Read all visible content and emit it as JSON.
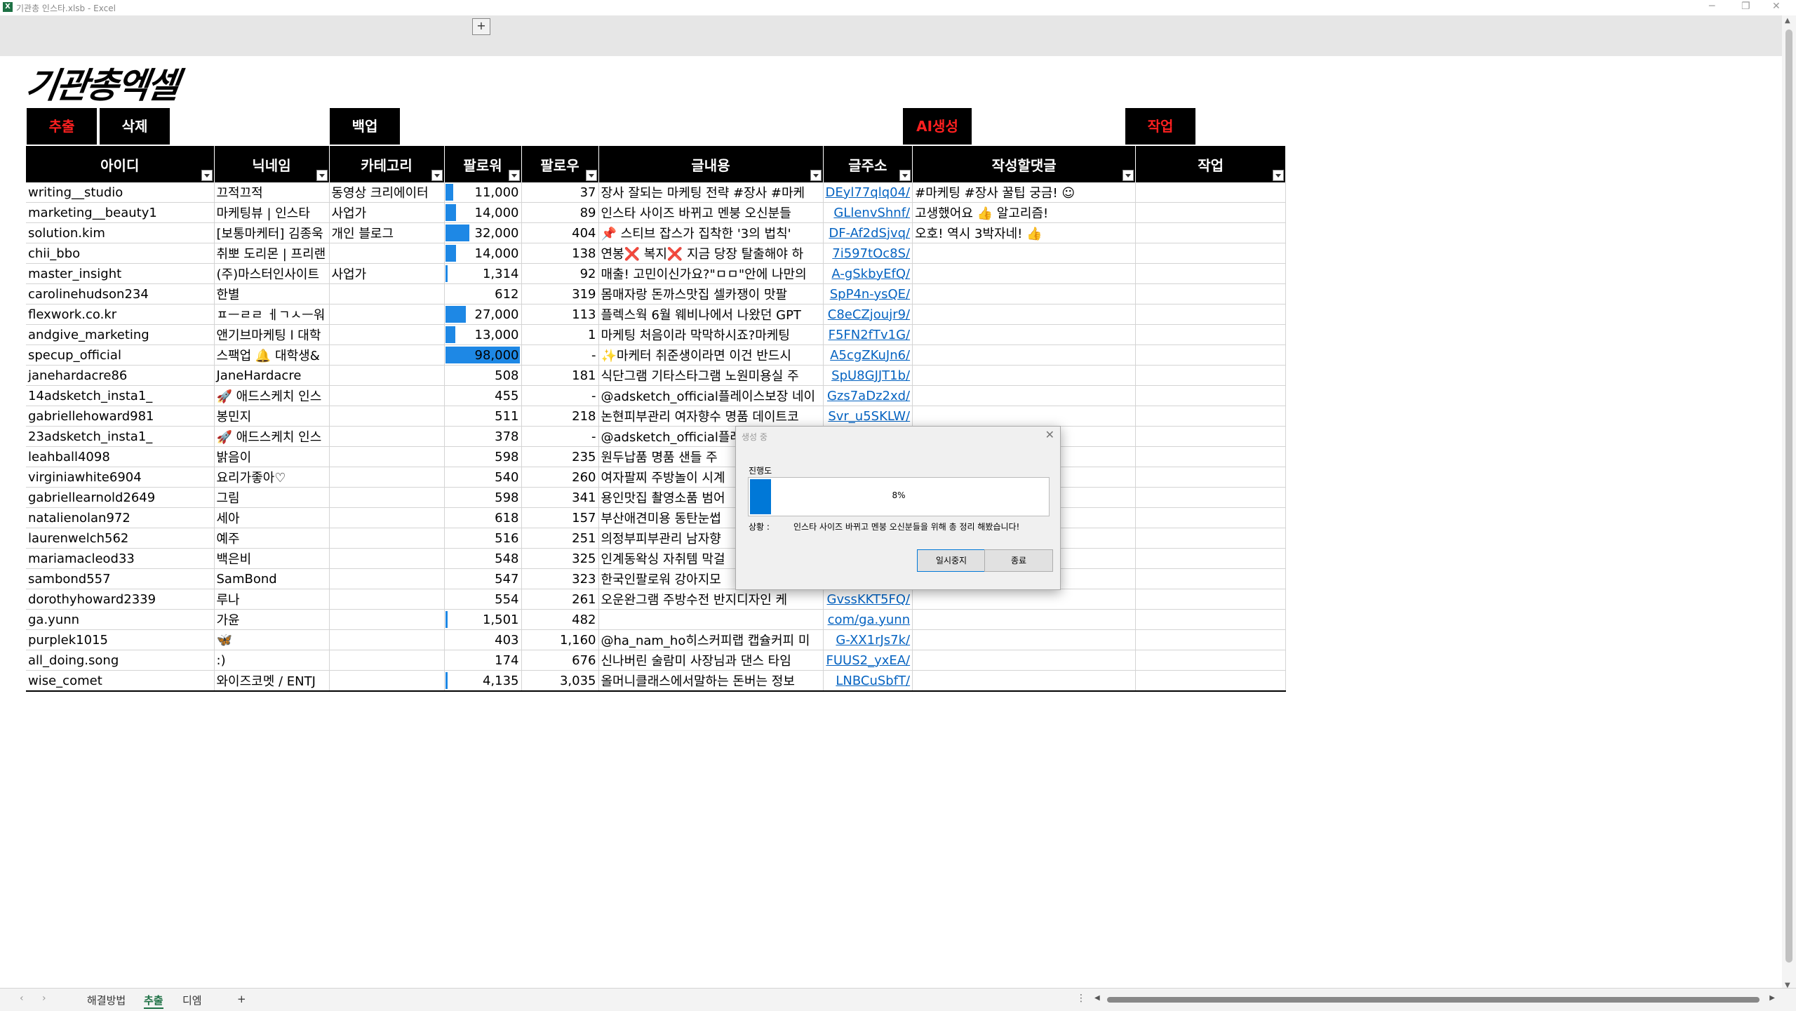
{
  "window": {
    "title": "기관총 인스타.xlsb - Excel",
    "app_icon": "X"
  },
  "ribbon": {
    "plus": "+"
  },
  "logo": "기관총엑셀",
  "buttons": {
    "extract": "추출",
    "delete": "삭제",
    "backup": "백업",
    "ai": "AI생성",
    "work": "작업"
  },
  "columns": [
    "아이디",
    "닉네임",
    "카테고리",
    "팔로워",
    "팔로우",
    "글내용",
    "글주소",
    "작성할댓글",
    "작업"
  ],
  "rows": [
    {
      "id": "writing__studio",
      "nick": "끄적끄적",
      "cat": "동영상 크리에이터",
      "followers": "11,000",
      "fbar": 0.11,
      "follow": "37",
      "content": "장사 잘되는 마케팅 전략 #장사 #마케",
      "url": "DEyl77qlq04/",
      "reply": "#마케팅 #장사 꿀팁 궁금! ☺"
    },
    {
      "id": "marketing__beauty1",
      "nick": "마케팅뷰 | 인스타",
      "cat": "사업가",
      "followers": "14,000",
      "fbar": 0.14,
      "follow": "89",
      "content": "인스타 사이즈 바뀌고 멘붕 오신분들",
      "url": "GLlenvShnf/",
      "reply": "고생했어요 👍 알고리즘!"
    },
    {
      "id": "solution.kim",
      "nick": "[보통마케터] 김종욱",
      "cat": "개인 블로그",
      "followers": "32,000",
      "fbar": 0.32,
      "follow": "404",
      "content": "📌 스티브 잡스가 집착한 '3의 법칙'",
      "url": "DF-Af2dSjvq/",
      "reply": "오호! 역시 3박자네! 👍"
    },
    {
      "id": "chii_bbo",
      "nick": "취뽀 도리몬 | 프리랜",
      "cat": "",
      "followers": "14,000",
      "fbar": 0.14,
      "follow": "138",
      "content": "연봉❌ 복지❌ 지금 당장 탈출해야 하",
      "url": "7i597tOc8S/",
      "reply": ""
    },
    {
      "id": "master_insight",
      "nick": "(주)마스터인사이트",
      "cat": "사업가",
      "followers": "1,314",
      "fbar": 0.013,
      "follow": "92",
      "content": "매출! 고민이신가요?\"ㅁㅁ\"안에 나만의",
      "url": "A-gSkbyEfQ/",
      "reply": ""
    },
    {
      "id": "carolinehudson234",
      "nick": "한별",
      "cat": "",
      "followers": "612",
      "fbar": 0,
      "follow": "319",
      "content": "몸매자랑 돈까스맛집 셀카쟁이 맛팔",
      "url": "SpP4n-ysQE/",
      "reply": ""
    },
    {
      "id": "flexwork.co.kr",
      "nick": "ㅍㅡㄹㄹ ㅔㄱㅅㅡ워",
      "cat": "",
      "followers": "27,000",
      "fbar": 0.27,
      "follow": "113",
      "content": "플렉스웍 6월 웨비나에서 나왔던 GPT",
      "url": "C8eCZjoujr9/",
      "reply": ""
    },
    {
      "id": "andgive_marketing",
      "nick": "앤기브마케팅 l 대학",
      "cat": "",
      "followers": "13,000",
      "fbar": 0.13,
      "follow": "1",
      "content": "마케팅 처음이라 막막하시죠?마케팅",
      "url": "F5FN2fTv1G/",
      "reply": ""
    },
    {
      "id": "specup_official",
      "nick": "스팩업 🔔 대학생&",
      "cat": "",
      "followers": "98,000",
      "fbar": 0.98,
      "follow": "-",
      "content": "✨마케터 취준생이라면 이건 반드시",
      "url": "A5cgZKuJn6/",
      "reply": ""
    },
    {
      "id": "janehardacre86",
      "nick": "JaneHardacre",
      "cat": "",
      "followers": "508",
      "fbar": 0,
      "follow": "181",
      "content": "식단그램 기타스타그램 노원미용실 주",
      "url": "SpU8GJJT1b/",
      "reply": ""
    },
    {
      "id": "14adsketch_insta1_",
      "nick": "🚀 애드스케치 인스",
      "cat": "",
      "followers": "455",
      "fbar": 0,
      "follow": "-",
      "content": "@adsketch_official플레이스보장 네이",
      "url": "Gzs7aDz2xd/",
      "reply": ""
    },
    {
      "id": "gabriellehoward981",
      "nick": "봉민지",
      "cat": "",
      "followers": "511",
      "fbar": 0,
      "follow": "218",
      "content": "논현피부관리 여자향수 명품 데이트코",
      "url": "Svr_u5SKLW/",
      "reply": ""
    },
    {
      "id": "23adsketch_insta1_",
      "nick": "🚀 애드스케치 인스",
      "cat": "",
      "followers": "378",
      "fbar": 0,
      "follow": "-",
      "content": "@adsketch_official플레",
      "url": "",
      "reply": ""
    },
    {
      "id": "leahball4098",
      "nick": "밝음이",
      "cat": "",
      "followers": "598",
      "fbar": 0,
      "follow": "235",
      "content": "원두납품 명품 샌들 주",
      "url": "",
      "reply": ""
    },
    {
      "id": "virginiawhite6904",
      "nick": "요리가좋아♡",
      "cat": "",
      "followers": "540",
      "fbar": 0,
      "follow": "260",
      "content": "여자팔찌 주방놀이 시계",
      "url": "",
      "reply": ""
    },
    {
      "id": "gabriellearnold2649",
      "nick": "그림",
      "cat": "",
      "followers": "598",
      "fbar": 0,
      "follow": "341",
      "content": "용인맛집 촬영소품 범어",
      "url": "",
      "reply": ""
    },
    {
      "id": "natalienolan972",
      "nick": "세아",
      "cat": "",
      "followers": "618",
      "fbar": 0,
      "follow": "157",
      "content": "부산애견미용 동탄눈썹",
      "url": "",
      "reply": ""
    },
    {
      "id": "laurenwelch562",
      "nick": "예주",
      "cat": "",
      "followers": "516",
      "fbar": 0,
      "follow": "251",
      "content": "의정부피부관리 남자향",
      "url": "",
      "reply": ""
    },
    {
      "id": "mariamacleod33",
      "nick": "백은비",
      "cat": "",
      "followers": "548",
      "fbar": 0,
      "follow": "325",
      "content": "인계동왁싱 자취템 막걸",
      "url": "",
      "reply": ""
    },
    {
      "id": "sambond557",
      "nick": "SamBond",
      "cat": "",
      "followers": "547",
      "fbar": 0,
      "follow": "323",
      "content": "한국인팔로워 강아지모",
      "url": "",
      "reply": ""
    },
    {
      "id": "dorothyhoward2339",
      "nick": "루나",
      "cat": "",
      "followers": "554",
      "fbar": 0,
      "follow": "261",
      "content": "오운완그램 주방수전 반지디자인 케",
      "url": "GvssKKT5FQ/",
      "reply": ""
    },
    {
      "id": "ga.yunn",
      "nick": "가윤",
      "cat": "",
      "followers": "1,501",
      "fbar": 0.015,
      "follow": "482",
      "content": "",
      "url": "com/ga.yunn",
      "reply": ""
    },
    {
      "id": "purplek1015",
      "nick": "🦋",
      "cat": "",
      "followers": "403",
      "fbar": 0,
      "follow": "1,160",
      "content": "@ha_nam_ho히스커피랩 캡슐커피 미",
      "url": "G-XX1rJs7k/",
      "reply": ""
    },
    {
      "id": "all_doing.song",
      "nick": ":)",
      "cat": "",
      "followers": "174",
      "fbar": 0,
      "follow": "676",
      "content": "신나버린 술람미 사장님과 댄스 타임",
      "url": "FUUS2_yxEA/",
      "reply": ""
    },
    {
      "id": "wise_comet",
      "nick": "와이즈코멧 / ENTJ",
      "cat": "",
      "followers": "4,135",
      "fbar": 0.041,
      "follow": "3,035",
      "content": "올머니클래스에서말하는 돈버는 정보",
      "url": "LNBCuSbfT/",
      "reply": ""
    }
  ],
  "dialog": {
    "title": "생성 중",
    "progress_label": "진행도",
    "progress_pct": 8,
    "progress_text": "8%",
    "status_label": "상황 :",
    "status_text": "인스타 사이즈 바뀌고 멘붕 오신분들을 위해 총 정리 해봤습니다!",
    "pause": "일시중지",
    "stop": "종료"
  },
  "sheets": {
    "tabs": [
      "해결방법",
      "추출",
      "디엠"
    ],
    "active": "추출",
    "add": "+"
  }
}
